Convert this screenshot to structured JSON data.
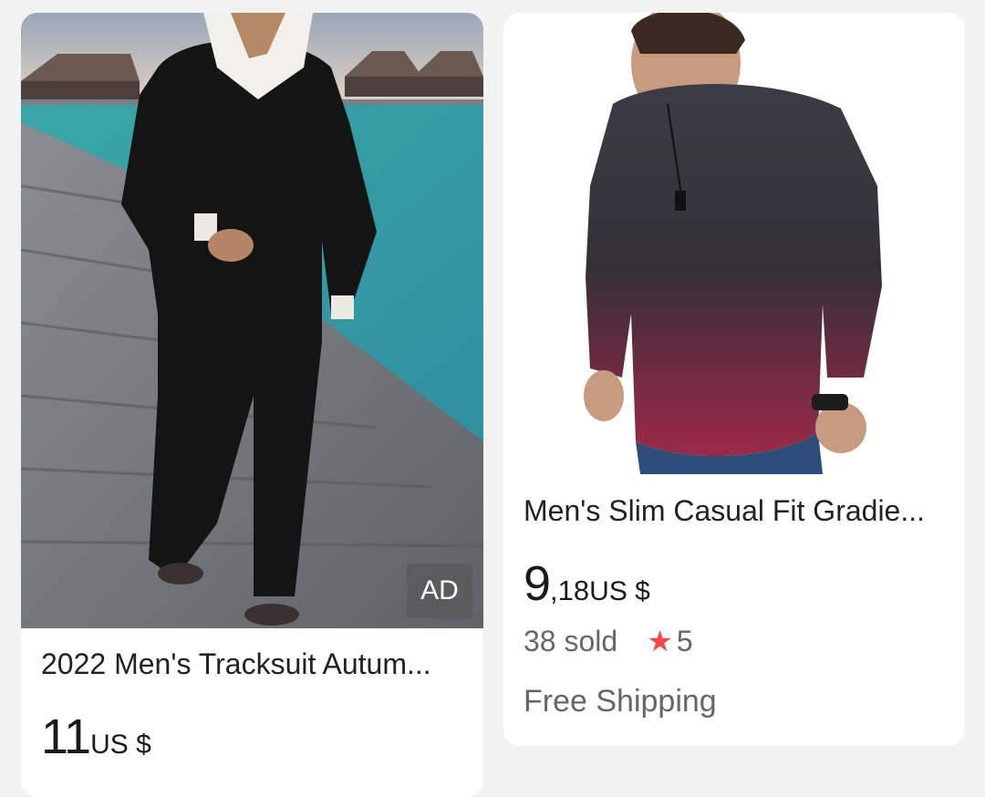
{
  "products": [
    {
      "title": "2022 Men's Tracksuit Autum...",
      "price_int": "11",
      "price_currency": "US $",
      "ad_label": "AD"
    },
    {
      "title": "Men's Slim Casual Fit Gradie...",
      "price_int": "9",
      "price_dec": ",18",
      "price_currency": "US $",
      "sold": "38 sold",
      "rating": "5",
      "shipping": "Free Shipping"
    }
  ],
  "colors": {
    "star": "#f04848",
    "background": "#f2f2f2",
    "card": "#ffffff"
  }
}
